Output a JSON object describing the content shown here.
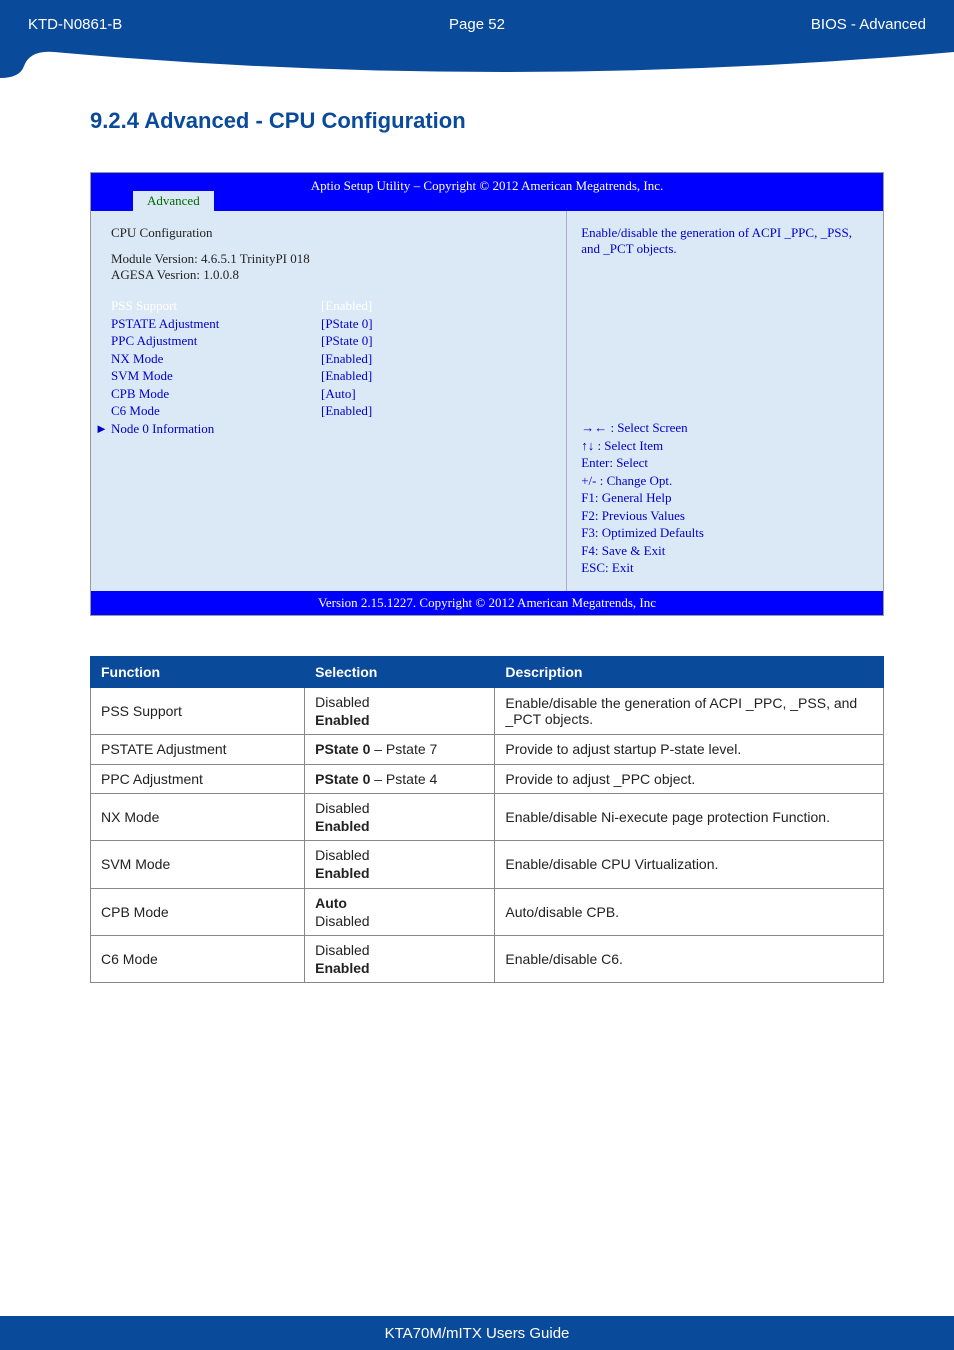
{
  "header": {
    "doc_id": "KTD-N0861-B",
    "page_label": "Page 52",
    "breadcrumb": "BIOS  - Advanced"
  },
  "section_title": "9.2.4  Advanced  -  CPU Configuration",
  "bios": {
    "top_title": "Aptio Setup Utility  –  Copyright © 2012 American Megatrends, Inc.",
    "tab": "Advanced",
    "heading": "CPU Configuration",
    "module_line": "Module Version: 4.6.5.1 TrinityPI 018",
    "agesa_line": "AGESA Vesrion: 1.0.0.8",
    "settings": [
      {
        "k": "PSS Support",
        "v": "[Enabled]",
        "highlight": true
      },
      {
        "k": "PSTATE Adjustment",
        "v": "[PState 0]"
      },
      {
        "k": "PPC Adjustment",
        "v": "[PState 0]"
      },
      {
        "k": "NX Mode",
        "v": "[Enabled]"
      },
      {
        "k": "SVM Mode",
        "v": "[Enabled]"
      },
      {
        "k": "CPB Mode",
        "v": "[Auto]"
      },
      {
        "k": "C6 Mode",
        "v": "[Enabled]"
      }
    ],
    "submenu": "Node 0 Information",
    "help_text": "Enable/disable the generation of ACPI _PPC, _PSS, and _PCT objects.",
    "nav": [
      "→← : Select Screen",
      "↑↓ : Select Item",
      "Enter: Select",
      "+/- : Change Opt.",
      "F1: General Help",
      "F2: Previous Values",
      "F3: Optimized Defaults",
      "F4: Save & Exit",
      "ESC: Exit"
    ],
    "footer": "Version 2.15.1227. Copyright © 2012 American Megatrends, Inc"
  },
  "table": {
    "headers": [
      "Function",
      "Selection",
      "Description"
    ],
    "rows": [
      {
        "fn": "PSS Support",
        "sel": [
          {
            "t": "Disabled",
            "b": false
          },
          {
            "t": "Enabled",
            "b": true
          }
        ],
        "desc": "Enable/disable the generation of ACPI _PPC, _PSS, and _PCT objects."
      },
      {
        "fn": "PSTATE Adjustment",
        "sel": [
          {
            "t": "PState 0",
            "b": true,
            "suffix": " – Pstate 7"
          }
        ],
        "desc": "Provide to adjust startup P-state level."
      },
      {
        "fn": "PPC Adjustment",
        "sel": [
          {
            "t": "PState 0",
            "b": true,
            "suffix": " – Pstate 4"
          }
        ],
        "desc": "Provide to adjust _PPC object."
      },
      {
        "fn": "NX Mode",
        "sel": [
          {
            "t": "Disabled",
            "b": false
          },
          {
            "t": "Enabled",
            "b": true
          }
        ],
        "desc": "Enable/disable Ni-execute page protection Function."
      },
      {
        "fn": "SVM Mode",
        "sel": [
          {
            "t": "Disabled",
            "b": false
          },
          {
            "t": "Enabled",
            "b": true
          }
        ],
        "desc": "Enable/disable CPU Virtualization."
      },
      {
        "fn": "CPB Mode",
        "sel": [
          {
            "t": "Auto",
            "b": true
          },
          {
            "t": "Disabled",
            "b": false
          }
        ],
        "desc": "Auto/disable CPB."
      },
      {
        "fn": "C6 Mode",
        "sel": [
          {
            "t": "Disabled",
            "b": false
          },
          {
            "t": "Enabled",
            "b": true
          }
        ],
        "desc": "Enable/disable C6."
      }
    ]
  },
  "footer": {
    "guide": "KTA70M/mITX Users Guide"
  }
}
